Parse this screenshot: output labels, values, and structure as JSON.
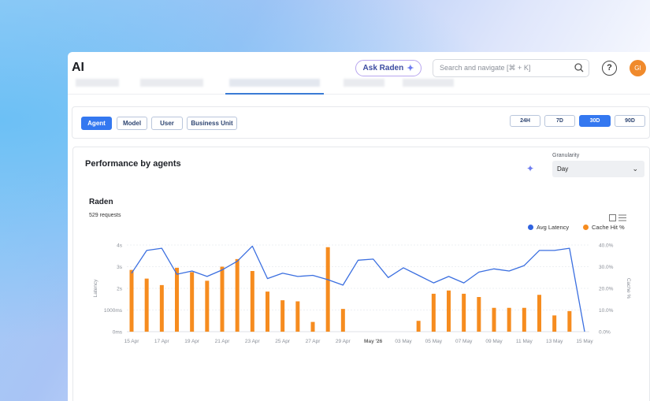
{
  "app": {
    "title": "AI"
  },
  "header": {
    "ask_label": "Ask Raden",
    "search_placeholder": "Search and navigate [⌘ + K]",
    "help_label": "?",
    "avatar_initials": "GI"
  },
  "filters": {
    "dimensions": [
      {
        "label": "Agent",
        "active": true
      },
      {
        "label": "Model",
        "active": false
      },
      {
        "label": "User",
        "active": false
      },
      {
        "label": "Business Unit",
        "active": false
      }
    ],
    "ranges": [
      {
        "label": "24H",
        "active": false
      },
      {
        "label": "7D",
        "active": false
      },
      {
        "label": "30D",
        "active": true
      },
      {
        "label": "90D",
        "active": false
      }
    ]
  },
  "panel": {
    "title": "Performance by agents",
    "granularity_label": "Granularity",
    "granularity_value": "Day"
  },
  "chart_card": {
    "title": "Raden",
    "subtitle": "529 requests"
  },
  "colors": {
    "latency": "#3b6fe0",
    "cache": "#f68c1f",
    "accent": "#3478f0"
  },
  "chart_data": {
    "type": "line+bar",
    "title": "Raden",
    "legend_position": "top-right",
    "grid": true,
    "x_tick_labels": [
      "15 Apr",
      "17 Apr",
      "19 Apr",
      "21 Apr",
      "23 Apr",
      "25 Apr",
      "27 Apr",
      "29 Apr",
      "May '26",
      "03 May",
      "05 May",
      "07 May",
      "09 May",
      "11 May",
      "13 May",
      "15 May"
    ],
    "y_left": {
      "label": "Latency",
      "ticks": [
        "0ms",
        "1000ms",
        "2s",
        "3s",
        "4s"
      ],
      "range_ms": [
        0,
        4000
      ]
    },
    "y_right": {
      "label": "Cache %",
      "ticks": [
        "0.0%",
        "10.0%",
        "20.0%",
        "30.0%",
        "40.0%"
      ],
      "range": [
        0,
        40
      ]
    },
    "dates": [
      "15 Apr",
      "16 Apr",
      "17 Apr",
      "18 Apr",
      "19 Apr",
      "20 Apr",
      "21 Apr",
      "22 Apr",
      "23 Apr",
      "24 Apr",
      "25 Apr",
      "26 Apr",
      "27 Apr",
      "28 Apr",
      "29 Apr",
      "30 Apr",
      "01 May",
      "02 May",
      "03 May",
      "04 May",
      "05 May",
      "06 May",
      "07 May",
      "08 May",
      "09 May",
      "10 May",
      "11 May",
      "12 May",
      "13 May",
      "14 May",
      "15 May"
    ],
    "series": [
      {
        "name": "Avg Latency",
        "kind": "line",
        "axis": "left",
        "values_ms": [
          2700,
          3750,
          3850,
          2650,
          2800,
          2550,
          2850,
          3250,
          3950,
          2450,
          2700,
          2550,
          2600,
          2400,
          2150,
          3300,
          3350,
          2500,
          2950,
          2600,
          2250,
          2550,
          2250,
          2750,
          2900,
          2800,
          3050,
          3750,
          3750,
          3850,
          0
        ]
      },
      {
        "name": "Cache Hit %",
        "kind": "bar",
        "axis": "right",
        "values": [
          28.5,
          24.5,
          21.5,
          29.5,
          27.5,
          23.5,
          30,
          33.5,
          28,
          18.5,
          14.5,
          14,
          4.5,
          39,
          10.5,
          0,
          0,
          0,
          0,
          5,
          17.5,
          19,
          17.5,
          16,
          11,
          11,
          11,
          17,
          7.5,
          9.5,
          0
        ]
      }
    ]
  }
}
